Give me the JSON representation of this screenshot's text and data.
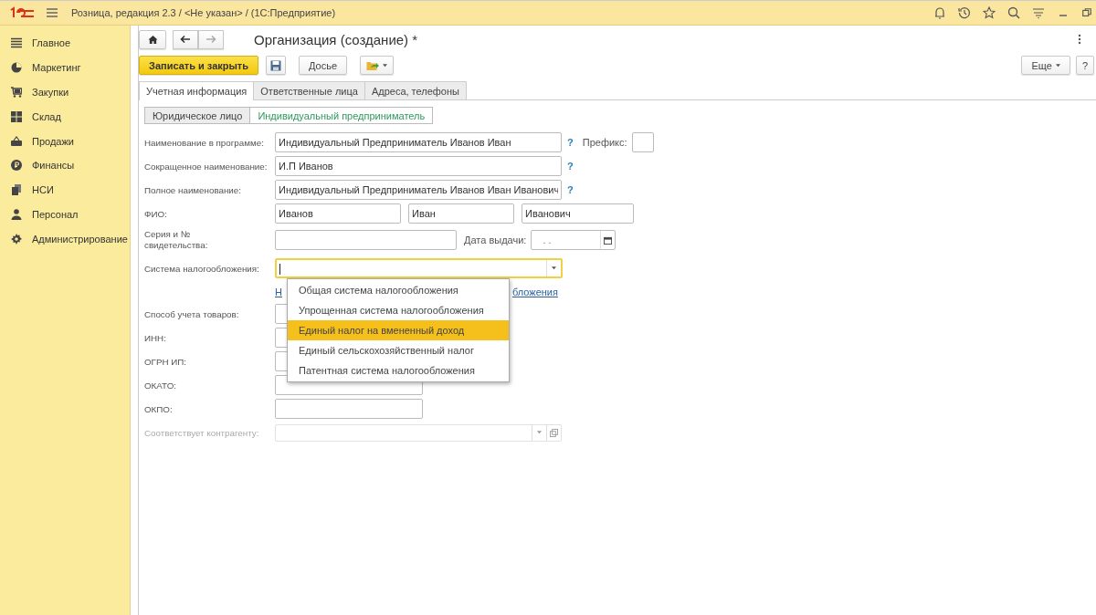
{
  "app_header": {
    "title": "Розница, редакция 2.3 / <Не указан> /  (1С:Предприятие)"
  },
  "sidebar": {
    "items": [
      {
        "label": "Главное",
        "kind": "menu"
      },
      {
        "label": "Маркетинг",
        "kind": "pie"
      },
      {
        "label": "Закупки",
        "kind": "cart"
      },
      {
        "label": "Склад",
        "kind": "grid"
      },
      {
        "label": "Продажи",
        "kind": "basket"
      },
      {
        "label": "Финансы",
        "kind": "coin"
      },
      {
        "label": "НСИ",
        "kind": "documents"
      },
      {
        "label": "Персонал",
        "kind": "person"
      },
      {
        "label": "Администрирование",
        "kind": "gear"
      }
    ]
  },
  "form": {
    "title": "Организация (создание) *",
    "save_close": "Записать и закрыть",
    "dossier": "Досье",
    "more": "Еще",
    "help": "?"
  },
  "tabs": [
    {
      "label": "Учетная информация",
      "selected": true
    },
    {
      "label": "Ответственные лица",
      "selected": false
    },
    {
      "label": "Адреса, телефоны",
      "selected": false
    }
  ],
  "subtabs": [
    {
      "label": "Юридическое лицо",
      "selected": false
    },
    {
      "label": "Индивидуальный предприниматель",
      "selected": true
    }
  ],
  "fields": {
    "name_in_program": {
      "label": "Наименование в программе:",
      "value": "Индивидуальный Предприниматель Иванов Иван",
      "help": "?"
    },
    "prefix": {
      "label": "Префикс:"
    },
    "short_name": {
      "label": "Сокращенное наименование:",
      "value": "И.П Иванов",
      "help": "?"
    },
    "full_name": {
      "label": "Полное наименование:",
      "value": "Индивидуальный Предприниматель Иванов Иван Иванович",
      "help": "?"
    },
    "fio": {
      "label": "ФИО:",
      "values": [
        "Иванов",
        "Иван",
        "Иванович"
      ]
    },
    "certificate": {
      "label": "Серия и № свидетельства:"
    },
    "issue_date": {
      "label": "Дата выдачи:",
      "value": ".  ."
    },
    "tax_system": {
      "label": "Система налогообложения:",
      "focused": true
    },
    "tax_link_fragments": [
      "Н",
      "бложения"
    ],
    "goods_accounting": {
      "label": "Способ учета товаров:"
    },
    "inn": {
      "label": "ИНН:"
    },
    "ogrn": {
      "label": "ОГРН ИП:"
    },
    "okato": {
      "label": "ОКАТО:"
    },
    "okpo": {
      "label": "ОКПО:"
    },
    "counterparty": {
      "label": "Соответствует контрагенту:",
      "disabled": true
    }
  },
  "dropdown": {
    "items": [
      {
        "label": "Общая система налогообложения",
        "selected": false
      },
      {
        "label": "Упрощенная система налогообложения",
        "selected": false
      },
      {
        "label": "Единый налог на вмененный доход",
        "selected": true
      },
      {
        "label": "Единый сельскохозяйственный налог",
        "selected": false
      },
      {
        "label": "Патентная система налогообложения",
        "selected": false
      }
    ]
  }
}
